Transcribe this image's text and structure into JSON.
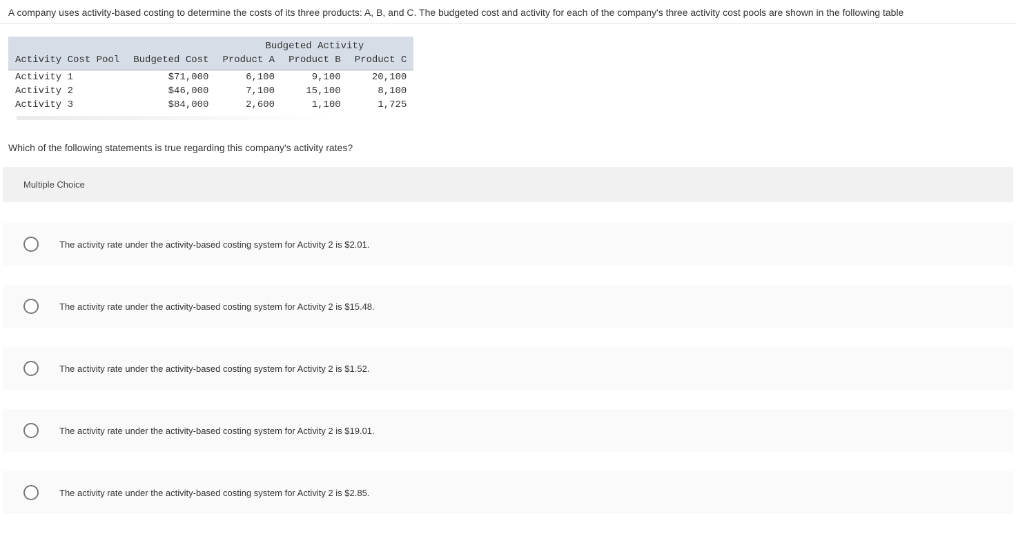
{
  "question": {
    "intro": "A company uses activity-based costing to determine the costs of its three products: A, B, and C. The budgeted cost and activity for each of the company's three activity cost pools are shown in the following table",
    "sub": "Which of the following statements is true regarding this company's activity rates?"
  },
  "table": {
    "group_header": "Budgeted Activity",
    "col_pool": "Activity Cost Pool",
    "col_cost": "Budgeted Cost",
    "col_a": "Product A",
    "col_b": "Product B",
    "col_c": "Product C",
    "rows": [
      {
        "pool": "Activity 1",
        "cost": "$71,000",
        "a": "6,100",
        "b": "9,100",
        "c": "20,100"
      },
      {
        "pool": "Activity 2",
        "cost": "$46,000",
        "a": "7,100",
        "b": "15,100",
        "c": "8,100"
      },
      {
        "pool": "Activity 3",
        "cost": "$84,000",
        "a": "2,600",
        "b": "1,100",
        "c": "1,725"
      }
    ]
  },
  "mc_label": "Multiple Choice",
  "choices": [
    "The activity rate under the activity-based costing system for Activity 2 is $2.01.",
    "The activity rate under the activity-based costing system for Activity 2 is $15.48.",
    "The activity rate under the activity-based costing system for Activity 2 is $1.52.",
    "The activity rate under the activity-based costing system for Activity 2 is $19.01.",
    "The activity rate under the activity-based costing system for Activity 2 is $2.85."
  ]
}
